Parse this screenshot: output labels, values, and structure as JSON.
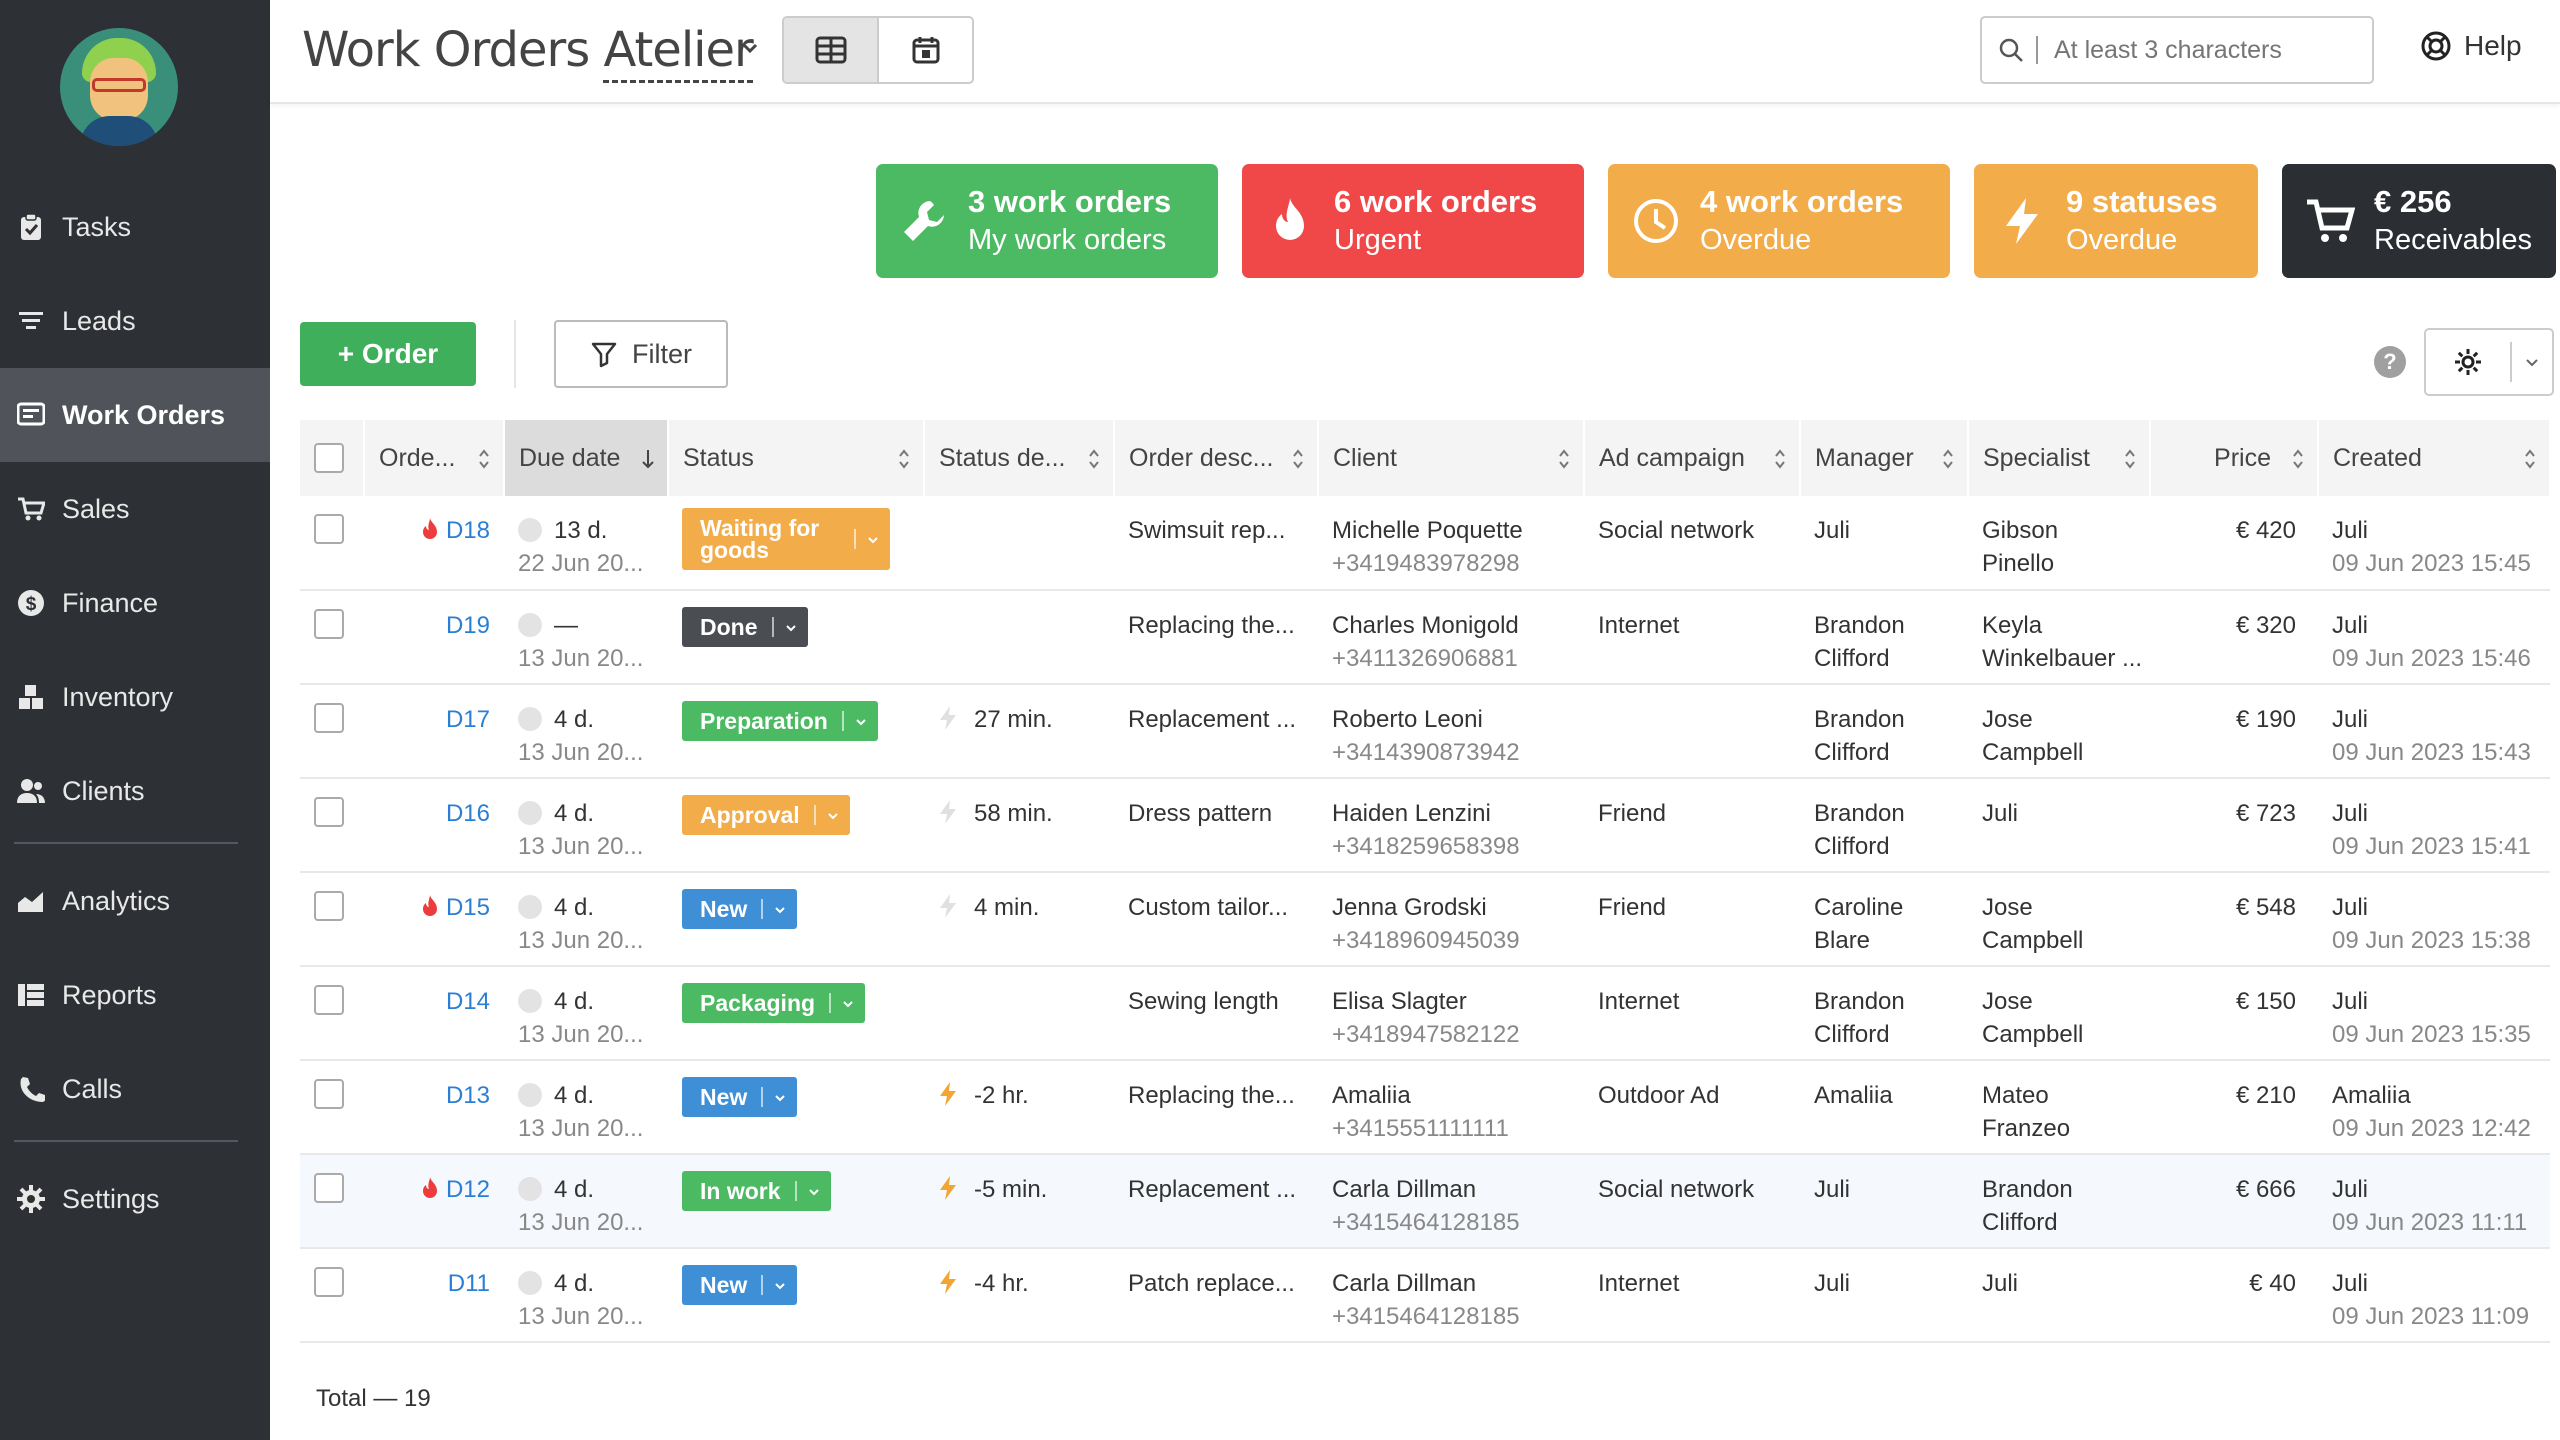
{
  "app": {
    "title": "Work Orders",
    "subtitle": "Atelier"
  },
  "sidebar": {
    "items": [
      {
        "label": "Tasks",
        "icon": "clipboard-icon"
      },
      {
        "label": "Leads",
        "icon": "funnel-icon"
      },
      {
        "label": "Work Orders",
        "icon": "work-orders-icon",
        "active": true
      },
      {
        "label": "Sales",
        "icon": "cart-icon"
      },
      {
        "label": "Finance",
        "icon": "dollar-icon"
      },
      {
        "label": "Inventory",
        "icon": "boxes-icon"
      },
      {
        "label": "Clients",
        "icon": "users-icon"
      },
      {
        "label": "Analytics",
        "icon": "chart-icon"
      },
      {
        "label": "Reports",
        "icon": "reports-icon"
      },
      {
        "label": "Calls",
        "icon": "phone-icon"
      },
      {
        "label": "Settings",
        "icon": "gear-icon"
      }
    ]
  },
  "search": {
    "placeholder": "At least 3 characters"
  },
  "help_label": "Help",
  "cards": [
    {
      "title": "3 work orders",
      "sub": "My work orders",
      "color": "#4cb963",
      "icon": "wrench-icon"
    },
    {
      "title": "6 work orders",
      "sub": "Urgent",
      "color": "#f04848",
      "icon": "fire-icon"
    },
    {
      "title": "4 work orders",
      "sub": "Overdue",
      "color": "#f2ac4a",
      "icon": "clock-icon"
    },
    {
      "title": "9 statuses",
      "sub": "Overdue",
      "color": "#f2ac4a",
      "icon": "bolt-icon"
    },
    {
      "title": "€ 256",
      "sub": "Receivables",
      "color": "#2b2e33",
      "icon": "cart-icon"
    }
  ],
  "toolbar": {
    "order_label": "+ Order",
    "filter_label": "Filter"
  },
  "table": {
    "columns": [
      "Orde...",
      "Due date",
      "Status",
      "Status de...",
      "Order desc...",
      "Client",
      "Ad campaign",
      "Manager",
      "Specialist",
      "Price",
      "Created"
    ],
    "rows": [
      {
        "urgent": true,
        "id": "D18",
        "due": "13 d.",
        "due_date": "22 Jun 20...",
        "status": "Waiting for goods",
        "status_color": "#f2ac4a",
        "status_tall": true,
        "status_delay": "",
        "delay_active": false,
        "desc": "Swimsuit rep...",
        "client": "Michelle Poquette",
        "phone": "+3419483978298",
        "campaign": "Social network",
        "manager": "Juli",
        "manager2": "",
        "specialist": "Gibson",
        "specialist2": "Pinello",
        "price": "€ 420",
        "created_by": "Juli",
        "created": "09 Jun 2023 15:45",
        "hl": false
      },
      {
        "urgent": false,
        "id": "D19",
        "due": "—",
        "due_date": "13 Jun 20...",
        "status": "Done",
        "status_color": "#4a4d52",
        "status_tall": false,
        "status_delay": "",
        "delay_active": false,
        "desc": "Replacing the...",
        "client": "Charles Monigold",
        "phone": "+3411326906881",
        "campaign": "Internet",
        "manager": "Brandon",
        "manager2": "Clifford",
        "specialist": "Keyla",
        "specialist2": "Winkelbauer ...",
        "price": "€ 320",
        "created_by": "Juli",
        "created": "09 Jun 2023 15:46",
        "hl": false
      },
      {
        "urgent": false,
        "id": "D17",
        "due": "4 d.",
        "due_date": "13 Jun 20...",
        "status": "Preparation",
        "status_color": "#4cb963",
        "status_tall": false,
        "status_delay": "27 min.",
        "delay_active": false,
        "desc": "Replacement ...",
        "client": "Roberto Leoni",
        "phone": "+3414390873942",
        "campaign": "",
        "manager": "Brandon",
        "manager2": "Clifford",
        "specialist": "Jose",
        "specialist2": "Campbell",
        "price": "€ 190",
        "created_by": "Juli",
        "created": "09 Jun 2023 15:43",
        "hl": false
      },
      {
        "urgent": false,
        "id": "D16",
        "due": "4 d.",
        "due_date": "13 Jun 20...",
        "status": "Approval",
        "status_color": "#f2ac4a",
        "status_tall": false,
        "status_delay": "58 min.",
        "delay_active": false,
        "desc": "Dress pattern",
        "client": "Haiden Lenzini",
        "phone": "+3418259658398",
        "campaign": "Friend",
        "manager": "Brandon",
        "manager2": "Clifford",
        "specialist": "Juli",
        "specialist2": "",
        "price": "€ 723",
        "created_by": "Juli",
        "created": "09 Jun 2023 15:41",
        "hl": false
      },
      {
        "urgent": true,
        "id": "D15",
        "due": "4 d.",
        "due_date": "13 Jun 20...",
        "status": "New",
        "status_color": "#3f8fd6",
        "status_tall": false,
        "status_delay": "4 min.",
        "delay_active": false,
        "desc": "Custom tailor...",
        "client": "Jenna Grodski",
        "phone": "+3418960945039",
        "campaign": "Friend",
        "manager": "Caroline",
        "manager2": "Blare",
        "specialist": "Jose",
        "specialist2": "Campbell",
        "price": "€ 548",
        "created_by": "Juli",
        "created": "09 Jun 2023 15:38",
        "hl": false
      },
      {
        "urgent": false,
        "id": "D14",
        "due": "4 d.",
        "due_date": "13 Jun 20...",
        "status": "Packaging",
        "status_color": "#4cb963",
        "status_tall": false,
        "status_delay": "",
        "delay_active": false,
        "desc": "Sewing length",
        "client": "Elisa Slagter",
        "phone": "+3418947582122",
        "campaign": "Internet",
        "manager": "Brandon",
        "manager2": "Clifford",
        "specialist": "Jose",
        "specialist2": "Campbell",
        "price": "€ 150",
        "created_by": "Juli",
        "created": "09 Jun 2023 15:35",
        "hl": false
      },
      {
        "urgent": false,
        "id": "D13",
        "due": "4 d.",
        "due_date": "13 Jun 20...",
        "status": "New",
        "status_color": "#3f8fd6",
        "status_tall": false,
        "status_delay": "-2 hr.",
        "delay_active": true,
        "desc": "Replacing the...",
        "client": "Amaliia",
        "phone": "+3415551111111",
        "campaign": "Outdoor Ad",
        "manager": "Amaliia",
        "manager2": "",
        "specialist": "Mateo",
        "specialist2": "Franzeo",
        "price": "€ 210",
        "created_by": "Amaliia",
        "created": "09 Jun 2023 12:42",
        "hl": false
      },
      {
        "urgent": true,
        "id": "D12",
        "due": "4 d.",
        "due_date": "13 Jun 20...",
        "status": "In work",
        "status_color": "#4cb963",
        "status_tall": false,
        "status_delay": "-5 min.",
        "delay_active": true,
        "desc": "Replacement ...",
        "client": "Carla Dillman",
        "phone": "+3415464128185",
        "campaign": "Social network",
        "manager": "Juli",
        "manager2": "",
        "specialist": "Brandon",
        "specialist2": "Clifford",
        "price": "€ 666",
        "created_by": "Juli",
        "created": "09 Jun 2023 11:11",
        "hl": true
      },
      {
        "urgent": false,
        "id": "D11",
        "due": "4 d.",
        "due_date": "13 Jun 20...",
        "status": "New",
        "status_color": "#3f8fd6",
        "status_tall": false,
        "status_delay": "-4 hr.",
        "delay_active": true,
        "desc": "Patch replace...",
        "client": "Carla Dillman",
        "phone": "+3415464128185",
        "campaign": "Internet",
        "manager": "Juli",
        "manager2": "",
        "specialist": "Juli",
        "specialist2": "",
        "price": "€ 40",
        "created_by": "Juli",
        "created": "09 Jun 2023 11:09",
        "hl": false
      }
    ],
    "total": "Total — 19"
  }
}
